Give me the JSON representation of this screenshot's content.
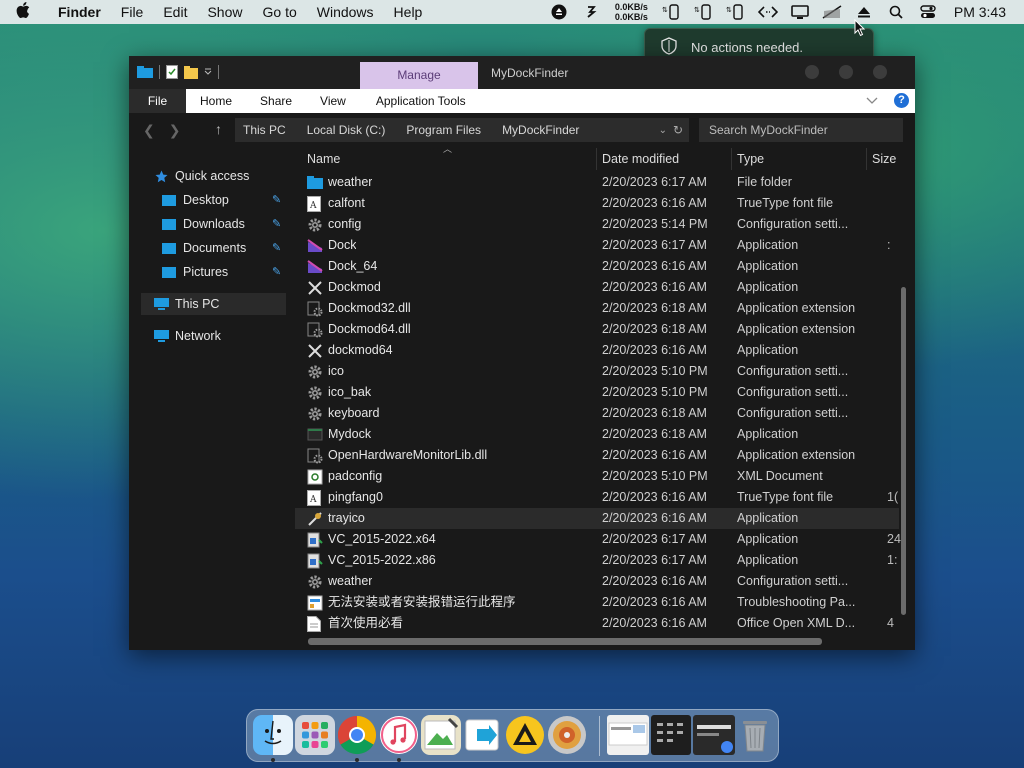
{
  "menubar": {
    "apple": "",
    "app_name": "Finder",
    "items": [
      "File",
      "Edit",
      "Show",
      "Go to",
      "Windows",
      "Help"
    ],
    "net_up": "0.0KB/s",
    "net_down": "0.0KB/s",
    "clock": "PM 3:43"
  },
  "notification": {
    "text": "No actions needed."
  },
  "window": {
    "title": "MyDockFinder",
    "manage_tab": "Manage",
    "ribbon_tabs": [
      "File",
      "Home",
      "Share",
      "View",
      "Application Tools"
    ],
    "breadcrumbs": [
      "This PC",
      "Local Disk (C:)",
      "Program Files",
      "MyDockFinder"
    ],
    "search_placeholder": "Search MyDockFinder"
  },
  "nav": {
    "quick_access": "Quick access",
    "items": [
      "Desktop",
      "Downloads",
      "Documents",
      "Pictures"
    ],
    "this_pc": "This PC",
    "network": "Network"
  },
  "columns": [
    "Name",
    "Date modified",
    "Type",
    "Size"
  ],
  "files": [
    {
      "name": "weather",
      "date": "2/20/2023 6:17 AM",
      "type": "File folder",
      "size": "",
      "icon": "folder-icon"
    },
    {
      "name": "calfont",
      "date": "2/20/2023 6:16 AM",
      "type": "TrueType font file",
      "size": "",
      "icon": "font-icon"
    },
    {
      "name": "config",
      "date": "2/20/2023 5:14 PM",
      "type": "Configuration setti...",
      "size": "",
      "icon": "gear-icon"
    },
    {
      "name": "Dock",
      "date": "2/20/2023 6:17 AM",
      "type": "Application",
      "size": ":",
      "icon": "dock-app-icon"
    },
    {
      "name": "Dock_64",
      "date": "2/20/2023 6:16 AM",
      "type": "Application",
      "size": "",
      "icon": "dock-app-icon"
    },
    {
      "name": "Dockmod",
      "date": "2/20/2023 6:16 AM",
      "type": "Application",
      "size": "",
      "icon": "tools-icon"
    },
    {
      "name": "Dockmod32.dll",
      "date": "2/20/2023 6:18 AM",
      "type": "Application extension",
      "size": "",
      "icon": "dll-icon"
    },
    {
      "name": "Dockmod64.dll",
      "date": "2/20/2023 6:18 AM",
      "type": "Application extension",
      "size": "",
      "icon": "dll-icon"
    },
    {
      "name": "dockmod64",
      "date": "2/20/2023 6:16 AM",
      "type": "Application",
      "size": "",
      "icon": "tools-icon"
    },
    {
      "name": "ico",
      "date": "2/20/2023 5:10 PM",
      "type": "Configuration setti...",
      "size": "",
      "icon": "gear-icon"
    },
    {
      "name": "ico_bak",
      "date": "2/20/2023 5:10 PM",
      "type": "Configuration setti...",
      "size": "",
      "icon": "gear-icon"
    },
    {
      "name": "keyboard",
      "date": "2/20/2023 6:18 AM",
      "type": "Configuration setti...",
      "size": "",
      "icon": "gear-icon"
    },
    {
      "name": "Mydock",
      "date": "2/20/2023 6:18 AM",
      "type": "Application",
      "size": "",
      "icon": "app-icon"
    },
    {
      "name": "OpenHardwareMonitorLib.dll",
      "date": "2/20/2023 6:16 AM",
      "type": "Application extension",
      "size": "",
      "icon": "dll-icon"
    },
    {
      "name": "padconfig",
      "date": "2/20/2023 5:10 PM",
      "type": "XML Document",
      "size": "",
      "icon": "xml-icon"
    },
    {
      "name": "pingfang0",
      "date": "2/20/2023 6:16 AM",
      "type": "TrueType font file",
      "size": "1(",
      "icon": "font-icon"
    },
    {
      "name": "trayico",
      "date": "2/20/2023 6:16 AM",
      "type": "Application",
      "size": "",
      "icon": "tray-app-icon",
      "highlight": true
    },
    {
      "name": "VC_2015-2022.x64",
      "date": "2/20/2023 6:17 AM",
      "type": "Application",
      "size": "24",
      "icon": "installer-icon"
    },
    {
      "name": "VC_2015-2022.x86",
      "date": "2/20/2023 6:17 AM",
      "type": "Application",
      "size": "1:",
      "icon": "installer-icon"
    },
    {
      "name": "weather",
      "date": "2/20/2023 6:16 AM",
      "type": "Configuration setti...",
      "size": "",
      "icon": "gear-icon"
    },
    {
      "name": "无法安装或者安装报错运行此程序",
      "date": "2/20/2023 6:16 AM",
      "type": "Troubleshooting Pa...",
      "size": "",
      "icon": "troubleshoot-icon"
    },
    {
      "name": "首次使用必看",
      "date": "2/20/2023 6:16 AM",
      "type": "Office Open XML D...",
      "size": "4",
      "icon": "document-icon"
    }
  ],
  "dock": {
    "apps": [
      "finder-icon",
      "launchpad-icon",
      "chrome-icon",
      "itunes-icon",
      "image-editor-icon",
      "remote-app-icon",
      "archive-icon",
      "dvd-icon"
    ],
    "recent": [
      "window-thumb-1",
      "window-thumb-2",
      "window-thumb-3",
      "trash-icon"
    ]
  }
}
